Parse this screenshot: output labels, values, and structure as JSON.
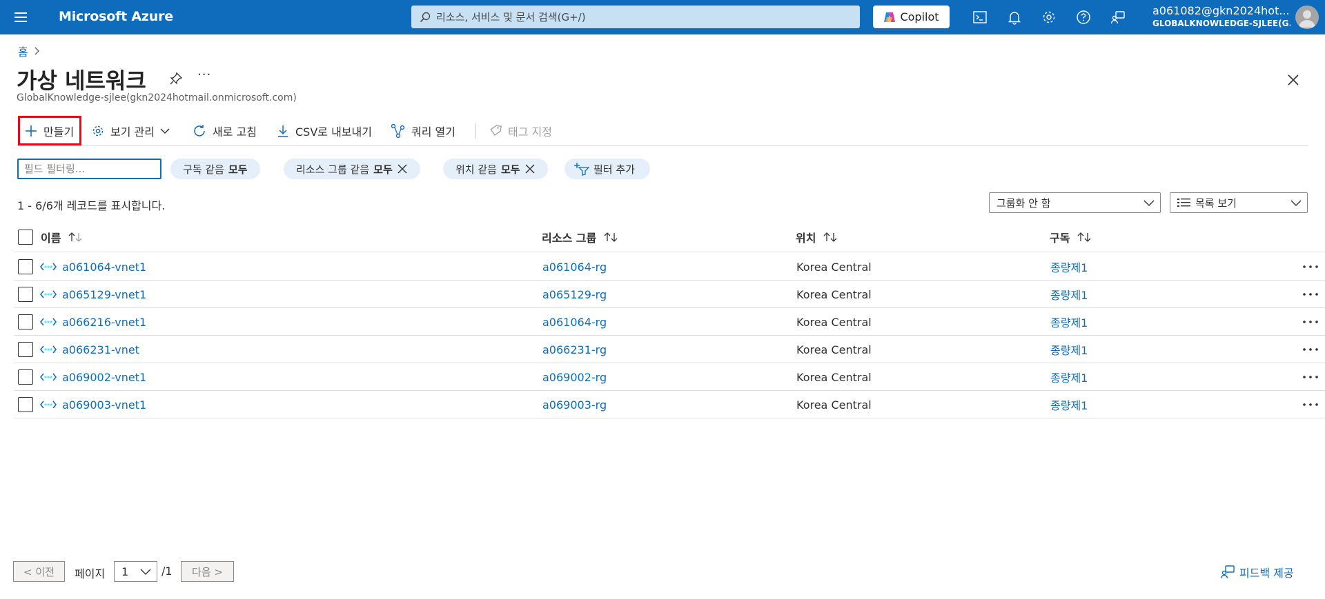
{
  "topbar": {
    "brand": "Microsoft Azure",
    "search_placeholder": "리소스, 서비스 및 문서 검색(G+/)",
    "copilot_label": "Copilot",
    "account_email": "a061082@gkn2024hot...",
    "account_tenant": "GLOBALKNOWLEDGE-SJLEE(G..."
  },
  "breadcrumb": {
    "home": "홈"
  },
  "header": {
    "title": "가상 네트워크",
    "more": "···",
    "subtitle": "GlobalKnowledge-sjlee(gkn2024hotmail.onmicrosoft.com)"
  },
  "commands": {
    "create": "만들기",
    "manage_view": "보기 관리",
    "refresh": "새로 고침",
    "export_csv": "CSV로 내보내기",
    "open_query": "쿼리 열기",
    "assign_tags": "태그 지정"
  },
  "filters": {
    "field_placeholder": "필드 필터링...",
    "subscription_label": "구독 같음",
    "subscription_value": "모두",
    "resource_group_label": "리소스 그룹 같음",
    "resource_group_value": "모두",
    "location_label": "위치 같음",
    "location_value": "모두",
    "add_filter": "필터 추가"
  },
  "records": {
    "summary": "1 - 6/6개 레코드를 표시합니다.",
    "grouping": "그룹화 안 함",
    "view_mode": "목록 보기"
  },
  "table": {
    "columns": {
      "name": "이름",
      "resource_group": "리소스 그룹",
      "location": "위치",
      "subscription": "구독"
    },
    "rows": [
      {
        "name": "a061064-vnet1",
        "resource_group": "a061064-rg",
        "location": "Korea Central",
        "subscription": "종량제1"
      },
      {
        "name": "a065129-vnet1",
        "resource_group": "a065129-rg",
        "location": "Korea Central",
        "subscription": "종량제1"
      },
      {
        "name": "a066216-vnet1",
        "resource_group": "a061064-rg",
        "location": "Korea Central",
        "subscription": "종량제1"
      },
      {
        "name": "a066231-vnet",
        "resource_group": "a066231-rg",
        "location": "Korea Central",
        "subscription": "종량제1"
      },
      {
        "name": "a069002-vnet1",
        "resource_group": "a069002-rg",
        "location": "Korea Central",
        "subscription": "종량제1"
      },
      {
        "name": "a069003-vnet1",
        "resource_group": "a069003-rg",
        "location": "Korea Central",
        "subscription": "종량제1"
      }
    ]
  },
  "pager": {
    "prev": "< 이전",
    "page_label": "페이지",
    "page_value": "1",
    "page_total": "/1",
    "next": "다음 >"
  },
  "feedback": "피드백 제공",
  "colors": {
    "brand_blue": "#0f6cbd",
    "search_bg": "#c7e0f4",
    "pill_bg": "#e5effa",
    "highlight_red": "#e00b1c",
    "vnet_icon_dots": "#50e6ff"
  },
  "icons": {
    "menu": "hamburger-icon",
    "search": "search-icon",
    "copilot": "copilot-logo-icon",
    "cloud_shell": "terminal-icon",
    "notifications": "bell-icon",
    "settings": "gear-icon",
    "help": "question-icon",
    "feedback": "feedback-person-icon",
    "vnet": "virtual-network-icon"
  }
}
